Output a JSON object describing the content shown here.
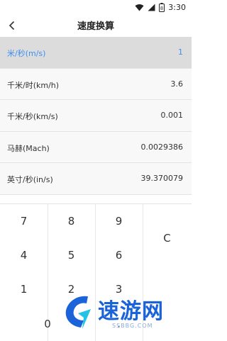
{
  "status": {
    "time": "3:30",
    "battery": "8"
  },
  "header": {
    "title": "速度换算"
  },
  "rows": [
    {
      "label": "米/秒(m/s)",
      "value": "1",
      "active": true
    },
    {
      "label": "千米/时(km/h)",
      "value": "3.6",
      "active": false
    },
    {
      "label": "千米/秒(km/s)",
      "value": "0.001",
      "active": false
    },
    {
      "label": "马赫(Mach)",
      "value": "0.0029386",
      "active": false
    },
    {
      "label": "英寸/秒(in/s)",
      "value": "39.370079",
      "active": false
    }
  ],
  "keypad": {
    "k7": "7",
    "k8": "8",
    "k9": "9",
    "clear": "C",
    "k4": "4",
    "k5": "5",
    "k6": "6",
    "k1": "1",
    "k2": "2",
    "k3": "3",
    "k0": "0",
    "dot": "."
  },
  "watermark": {
    "text": "速游网",
    "sub": "SSBBG.COM"
  },
  "colors": {
    "accent": "#3f8ff0",
    "brand": "#1a63d8"
  }
}
